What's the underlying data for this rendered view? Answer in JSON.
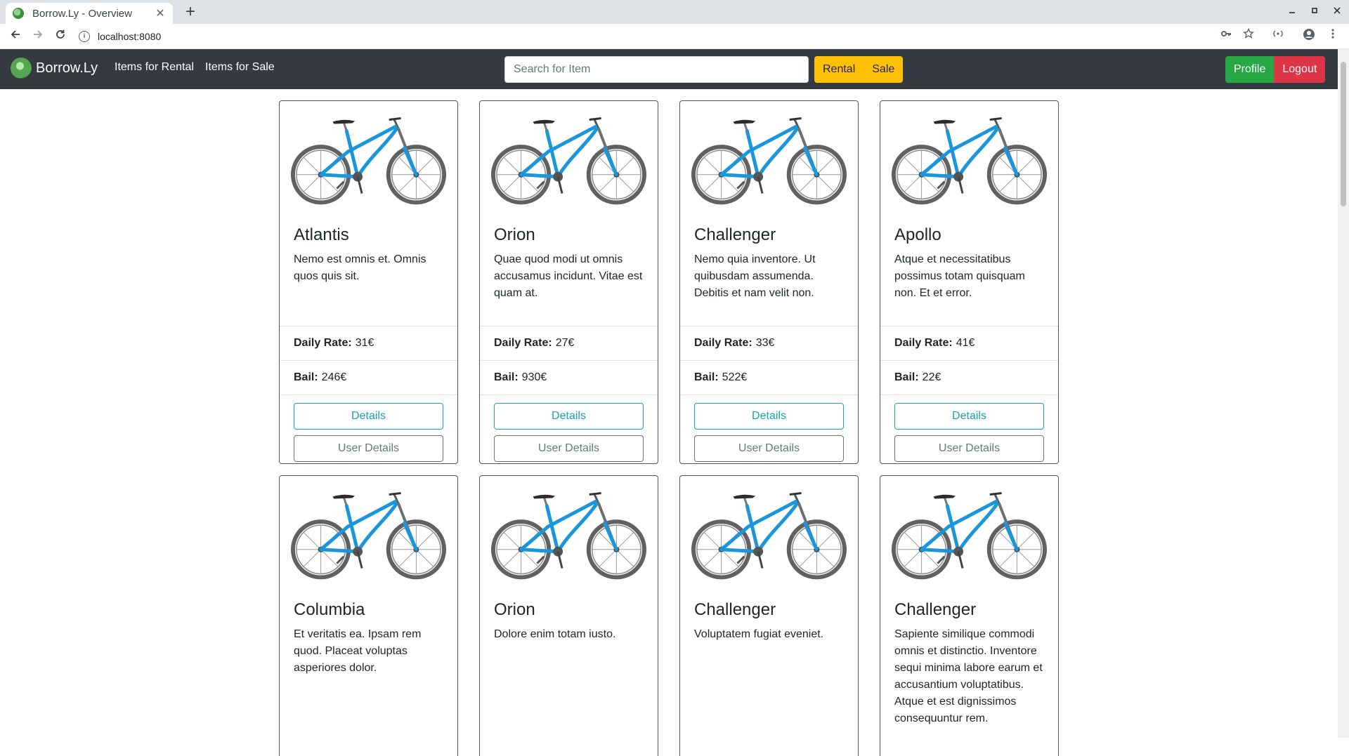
{
  "browser": {
    "tab_title": "Borrow.Ly - Overview",
    "close_glyph": "✕",
    "new_tab_glyph": "+",
    "url": "localhost:8080"
  },
  "navbar": {
    "brand": "Borrow.Ly",
    "links": [
      "Items for Rental",
      "Items for Sale"
    ],
    "search_placeholder": "Search for Item",
    "toggle": [
      "Rental",
      "Sale"
    ],
    "profile": "Profile",
    "logout": "Logout"
  },
  "colors": {
    "navbar_bg": "#343a40",
    "warning": "#ffc107",
    "success": "#28a745",
    "danger": "#dc3545",
    "info": "#17a2b8",
    "bike_frame": "#1a96dc"
  },
  "labels": {
    "daily_rate": "Daily Rate:",
    "bail": "Bail:",
    "details": "Details",
    "user_details": "User Details"
  },
  "items": [
    {
      "name": "Atlantis",
      "description": "Nemo est omnis et. Omnis quos quis sit.",
      "daily_rate": "31€",
      "bail": "246€"
    },
    {
      "name": "Orion",
      "description": "Quae quod modi ut omnis accusamus incidunt. Vitae est quam at.",
      "daily_rate": "27€",
      "bail": "930€"
    },
    {
      "name": "Challenger",
      "description": "Nemo quia inventore. Ut quibusdam assumenda. Debitis et nam velit non.",
      "daily_rate": "33€",
      "bail": "522€"
    },
    {
      "name": "Apollo",
      "description": "Atque et necessitatibus possimus totam quisquam non. Et et error.",
      "daily_rate": "41€",
      "bail": "22€"
    },
    {
      "name": "Columbia",
      "description": "Et veritatis ea. Ipsam rem quod. Placeat voluptas asperiores dolor."
    },
    {
      "name": "Orion",
      "description": "Dolore enim totam iusto."
    },
    {
      "name": "Challenger",
      "description": "Voluptatem fugiat eveniet."
    },
    {
      "name": "Challenger",
      "description": "Sapiente similique commodi omnis et distinctio. Inventore sequi minima labore earum et accusantium voluptatibus. Atque et est dignissimos consequuntur rem."
    }
  ]
}
